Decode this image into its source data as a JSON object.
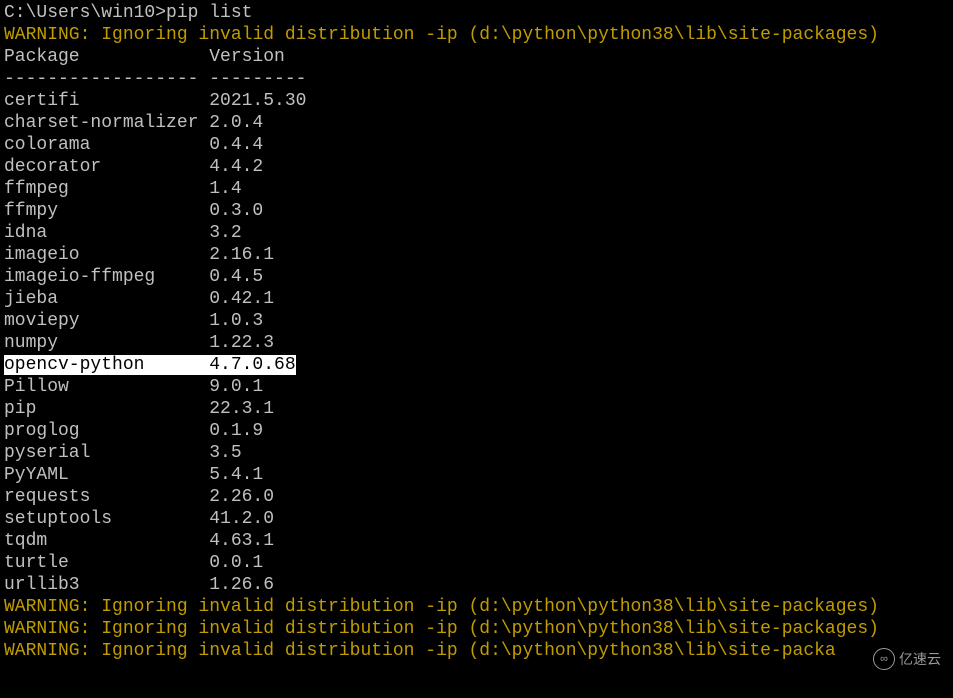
{
  "prompt": "C:\\Users\\win10>pip list",
  "warning_top": "WARNING: Ignoring invalid distribution -ip (d:\\python\\python38\\lib\\site-packages)",
  "header": {
    "pkg": "Package",
    "ver": "Version"
  },
  "divider": {
    "pkg": "------------------",
    "ver": "---------"
  },
  "packages": [
    {
      "name": "certifi",
      "version": "2021.5.30",
      "hl": false
    },
    {
      "name": "charset-normalizer",
      "version": "2.0.4",
      "hl": false
    },
    {
      "name": "colorama",
      "version": "0.4.4",
      "hl": false
    },
    {
      "name": "decorator",
      "version": "4.4.2",
      "hl": false
    },
    {
      "name": "ffmpeg",
      "version": "1.4",
      "hl": false
    },
    {
      "name": "ffmpy",
      "version": "0.3.0",
      "hl": false
    },
    {
      "name": "idna",
      "version": "3.2",
      "hl": false
    },
    {
      "name": "imageio",
      "version": "2.16.1",
      "hl": false
    },
    {
      "name": "imageio-ffmpeg",
      "version": "0.4.5",
      "hl": false
    },
    {
      "name": "jieba",
      "version": "0.42.1",
      "hl": false
    },
    {
      "name": "moviepy",
      "version": "1.0.3",
      "hl": false
    },
    {
      "name": "numpy",
      "version": "1.22.3",
      "hl": false
    },
    {
      "name": "opencv-python",
      "version": "4.7.0.68",
      "hl": true
    },
    {
      "name": "Pillow",
      "version": "9.0.1",
      "hl": false
    },
    {
      "name": "pip",
      "version": "22.3.1",
      "hl": false
    },
    {
      "name": "proglog",
      "version": "0.1.9",
      "hl": false
    },
    {
      "name": "pyserial",
      "version": "3.5",
      "hl": false
    },
    {
      "name": "PyYAML",
      "version": "5.4.1",
      "hl": false
    },
    {
      "name": "requests",
      "version": "2.26.0",
      "hl": false
    },
    {
      "name": "setuptools",
      "version": "41.2.0",
      "hl": false
    },
    {
      "name": "tqdm",
      "version": "4.63.1",
      "hl": false
    },
    {
      "name": "turtle",
      "version": "0.0.1",
      "hl": false
    },
    {
      "name": "urllib3",
      "version": "1.26.6",
      "hl": false
    }
  ],
  "warnings_bottom": [
    "WARNING: Ignoring invalid distribution -ip (d:\\python\\python38\\lib\\site-packages)",
    "WARNING: Ignoring invalid distribution -ip (d:\\python\\python38\\lib\\site-packages)",
    "WARNING: Ignoring invalid distribution -ip (d:\\python\\python38\\lib\\site-packa"
  ],
  "watermark": {
    "icon": "∞",
    "text": "亿速云"
  }
}
